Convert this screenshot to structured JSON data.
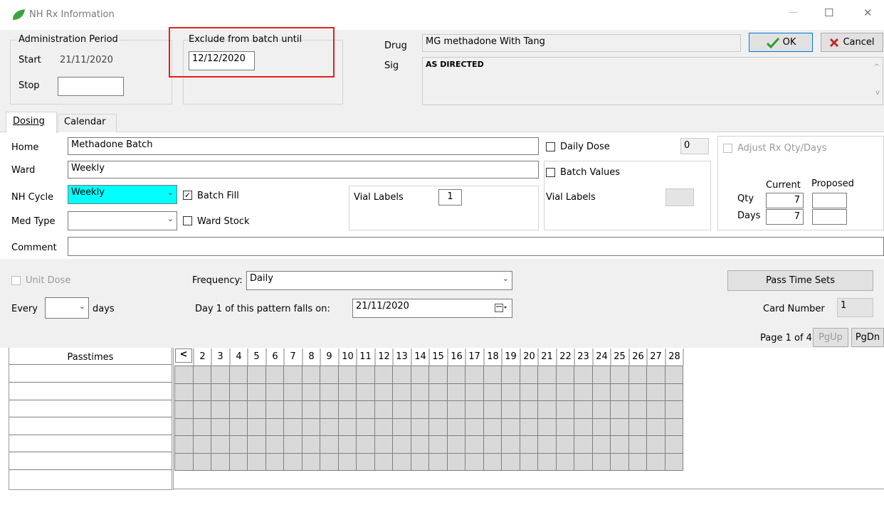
{
  "window": {
    "title": "NH Rx Information",
    "controls": {
      "minimize": "—",
      "maximize": "☐",
      "close": "✕"
    }
  },
  "admin_period": {
    "legend": "Administration Period",
    "start_label": "Start",
    "start_value": "21/11/2020",
    "stop_label": "Stop",
    "stop_value": ""
  },
  "exclude": {
    "legend": "Exclude from batch until",
    "value": "12/12/2020"
  },
  "drug": {
    "drug_label": "Drug",
    "drug_value": "MG methadone With Tang",
    "sig_label": "Sig",
    "sig_value": "AS DIRECTED"
  },
  "buttons": {
    "ok": "OK",
    "cancel": "Cancel"
  },
  "tabs": [
    {
      "label": "Dosing",
      "active": true
    },
    {
      "label": "Calendar",
      "active": false
    }
  ],
  "dosing": {
    "home_label": "Home",
    "home_value": "Methadone Batch",
    "ward_label": "Ward",
    "ward_value": "Weekly",
    "nh_cycle_label": "NH Cycle",
    "nh_cycle_value": "Weekly",
    "batch_fill_label": "Batch Fill",
    "batch_fill_checked": true,
    "med_type_label": "Med Type",
    "med_type_value": "",
    "ward_stock_label": "Ward Stock",
    "ward_stock_checked": false,
    "vial_labels_label": "Vial Labels",
    "vial_labels_value": "1",
    "comment_label": "Comment",
    "comment_value": "",
    "daily_dose_label": "Daily Dose",
    "daily_dose_value": "0",
    "batch_values_label": "Batch Values",
    "vial_labels2_label": "Vial Labels",
    "vial_labels2_value": "",
    "adjust_label": "Adjust Rx Qty/Days",
    "current_label": "Current",
    "proposed_label": "Proposed",
    "qty_label": "Qty",
    "qty_current": "7",
    "qty_proposed": "",
    "days_label": "Days",
    "days_current": "7",
    "days_proposed": ""
  },
  "schedule": {
    "unit_dose_label": "Unit Dose",
    "frequency_label": "Frequency:",
    "frequency_value": "Daily",
    "every_label": "Every",
    "every_value": "",
    "days_label": "days",
    "day1_label": "Day 1 of this pattern falls on:",
    "day1_value": "21/11/2020",
    "pass_time_sets": "Pass Time Sets",
    "card_number_label": "Card Number",
    "card_number_value": "1",
    "page_info": "Page 1 of 4",
    "pgup": "PgUp",
    "pgdn": "PgDn"
  },
  "grid": {
    "passtimes_header": "Passtimes",
    "prev_label": "<",
    "days": [
      "2",
      "3",
      "4",
      "5",
      "6",
      "7",
      "8",
      "9",
      "10",
      "11",
      "12",
      "13",
      "14",
      "15",
      "16",
      "17",
      "18",
      "19",
      "20",
      "21",
      "22",
      "23",
      "24",
      "25",
      "26",
      "27",
      "28"
    ]
  },
  "colors": {
    "nh_cycle_bg": "#00ffff",
    "highlight_border": "#e02020",
    "ok_check": "#2e9a2e",
    "cancel_x": "#c0282b",
    "grid_cell": "#d9d9d9",
    "logo_leaf": "#3fa33f"
  }
}
